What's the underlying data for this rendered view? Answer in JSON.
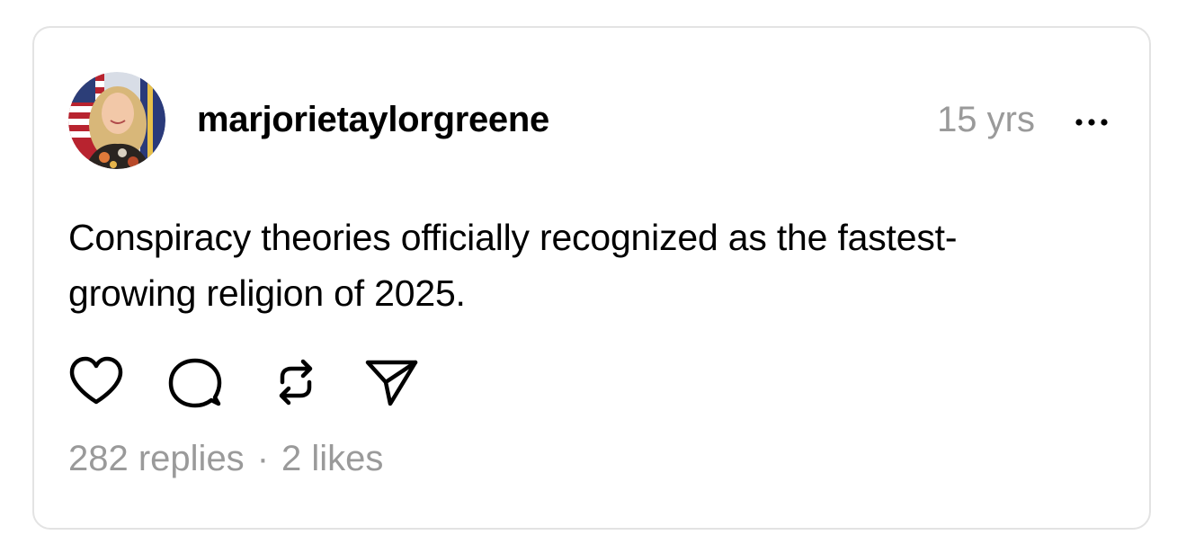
{
  "post": {
    "username": "marjorietaylorgreene",
    "timestamp": "15 yrs",
    "body": "Conspiracy theories officially recognized as the fastest-growing religion of 2025.",
    "avatar_icon": "profile-photo-with-american-flag",
    "more_icon": "ellipsis-icon"
  },
  "actions": [
    {
      "icon": "heart-icon",
      "label": "like"
    },
    {
      "icon": "comment-bubble-icon",
      "label": "reply"
    },
    {
      "icon": "repost-icon",
      "label": "repost"
    },
    {
      "icon": "paper-plane-icon",
      "label": "share"
    }
  ],
  "stats": {
    "replies": "282 replies",
    "separator": "·",
    "likes": "2 likes"
  },
  "colors": {
    "text": "#000000",
    "muted": "#9a9a9a",
    "border": "#e3e3e3",
    "background": "#ffffff"
  }
}
